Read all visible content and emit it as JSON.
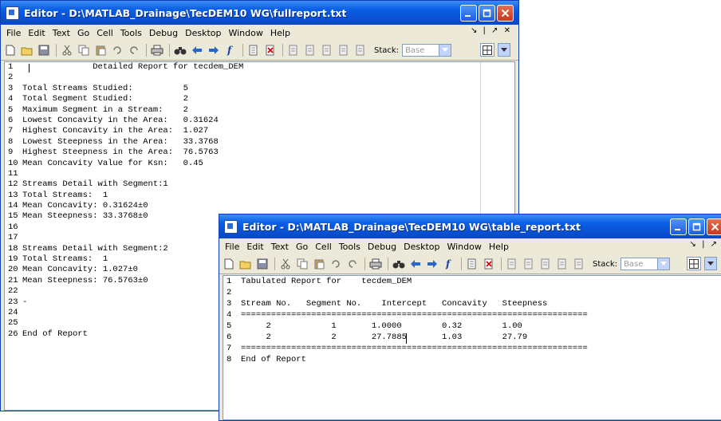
{
  "menus": [
    "File",
    "Edit",
    "Text",
    "Go",
    "Cell",
    "Tools",
    "Debug",
    "Desktop",
    "Window",
    "Help"
  ],
  "toolbar": {
    "stack_label": "Stack:",
    "stack_value": "Base",
    "func_label": "f"
  },
  "window1": {
    "title": "Editor - D:\\MATLAB_Drainage\\TecDEM10 WG\\fullreport.txt",
    "line_numbers": [
      "1",
      "2",
      "3",
      "4",
      "5",
      "6",
      "7",
      "8",
      "9",
      "10",
      "11",
      "12",
      "13",
      "14",
      "15",
      "16",
      "17",
      "18",
      "19",
      "20",
      "21",
      "22",
      "23",
      "24",
      "25",
      "26"
    ],
    "lines": [
      "              Detailed Report for tecdem_DEM",
      "",
      "Total Streams Studied:          5",
      "Total Segment Studied:          2",
      "Maximum Segment in a Stream:    2",
      "Lowest Concavity in the Area:   0.31624",
      "Highest Concavity in the Area:  1.027",
      "Lowest Steepness in the Area:   33.3768",
      "Highest Steepness in the Area:  76.5763",
      "Mean Concavity Value for Ksn:   0.45",
      "",
      "Streams Detail with Segment:1",
      "Total Streams:  1",
      "Mean Concavity: 0.31624±0",
      "Mean Steepness: 33.3768±0",
      "",
      "",
      "Streams Detail with Segment:2",
      "Total Streams:  1",
      "Mean Concavity: 1.027±0",
      "Mean Steepness: 76.5763±0",
      "",
      "-",
      "",
      "",
      "End of Report"
    ]
  },
  "window2": {
    "title": "Editor - D:\\MATLAB_Drainage\\TecDEM10 WG\\table_report.txt",
    "line_numbers": [
      "1",
      "2",
      "3",
      "4",
      "5",
      "6",
      "7",
      "8"
    ],
    "lines": [
      "Tabulated Report for    tecdem_DEM",
      "",
      "Stream No.   Segment No.    Intercept   Concavity   Steepness",
      "=====================================================================",
      "     2            1       1.0000        0.32        1.00",
      "     2            2       27.7885       1.03        27.79",
      "=====================================================================",
      "End of Report"
    ]
  }
}
